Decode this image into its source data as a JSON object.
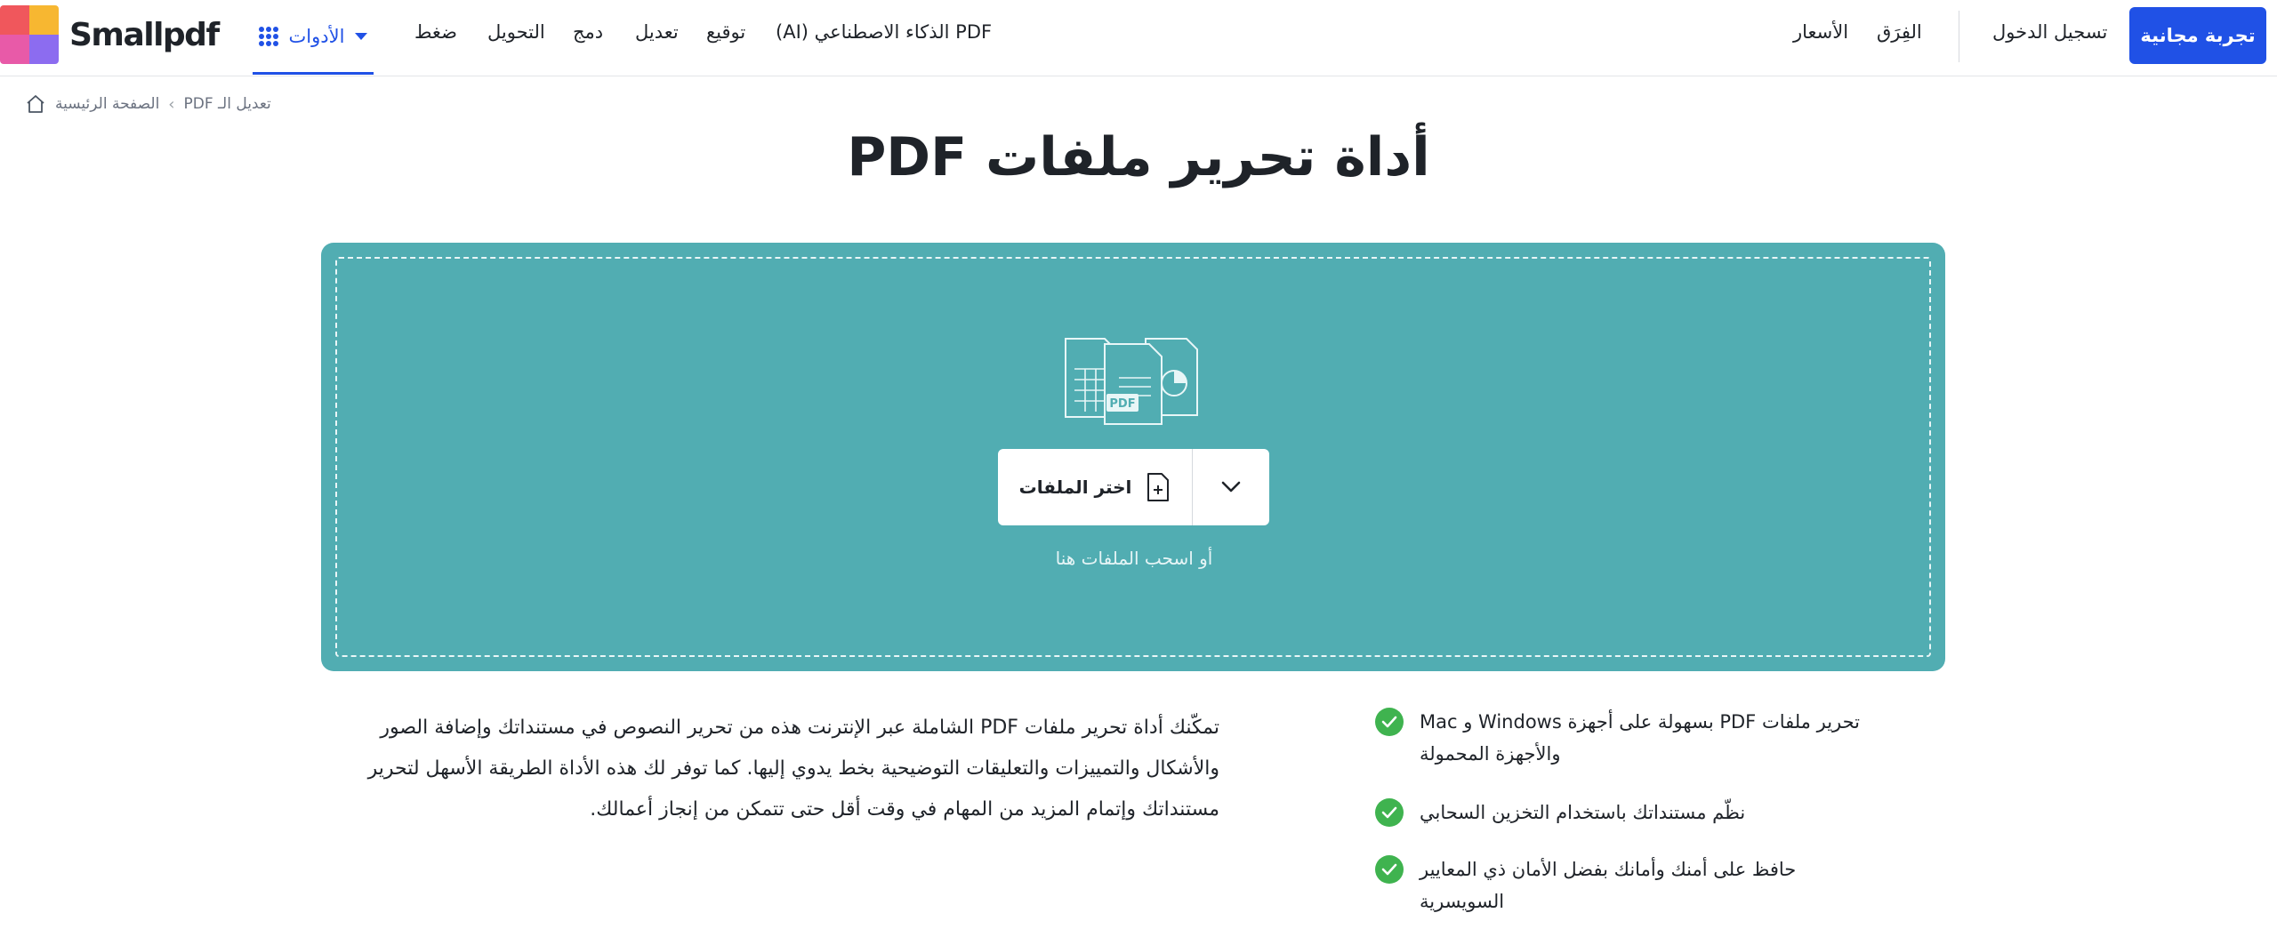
{
  "header": {
    "logo_text": "Smallpdf",
    "tools_label": "الأدوات",
    "nav": [
      "ضغط",
      "التحويل",
      "دمج",
      "تعديل",
      "توقيع",
      "PDF الذكاء الاصطناعي (AI)"
    ],
    "pricing": "الأسعار",
    "teams": "الفِرَق",
    "login": "تسجيل الدخول",
    "cta": "تجربة مجانية"
  },
  "breadcrumb": {
    "home": "الصفحة الرئيسية",
    "current": "تعديل الـ PDF"
  },
  "page_title": "أداة تحرير ملفات PDF",
  "dropzone": {
    "illustration_label": "PDF",
    "choose_files": "اختر الملفات",
    "hint": "أو اسحب الملفات هنا"
  },
  "description": "تمكّنك أداة تحرير ملفات PDF الشاملة عبر الإنترنت هذه من تحرير النصوص في مستنداتك وإضافة الصور والأشكال والتمييزات والتعليقات التوضيحية بخط يدوي إليها. كما توفر لك هذه الأداة الطريقة الأسهل لتحرير مستنداتك وإتمام المزيد من المهام في وقت أقل حتى تتمكن من إنجاز أعمالك.",
  "features": [
    "تحرير ملفات PDF بسهولة على أجهزة Windows و Mac والأجهزة المحمولة",
    "نظّم مستنداتك باستخدام التخزين السحابي",
    "حافظ على أمنك وأمانك بفضل الأمان ذي المعايير السويسرية"
  ],
  "colors": {
    "accent": "#2051e6",
    "dropzone": "#51adb2",
    "check": "#3fb34f"
  }
}
